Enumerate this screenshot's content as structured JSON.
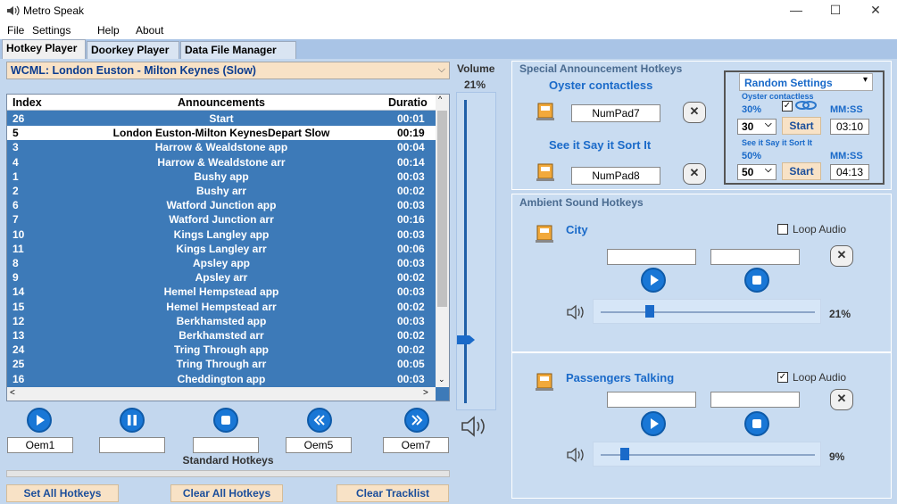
{
  "window": {
    "title": "Metro Speak",
    "minimize": "—",
    "maximize": "☐",
    "close": "✕"
  },
  "menu": [
    "File",
    "Settings",
    "Help",
    "About"
  ],
  "tabs": [
    "Hotkey Player",
    "Doorkey Player",
    "Data File Manager"
  ],
  "playlist": {
    "selected": "WCML: London Euston - Milton Keynes (Slow)",
    "columns": [
      "Index",
      "Announcements",
      "Duratio"
    ],
    "rows": [
      {
        "index": "26",
        "announcement": "Start",
        "duration": "00:01"
      },
      {
        "index": "5",
        "announcement": "London Euston-Milton KeynesDepart Slow",
        "duration": "00:19"
      },
      {
        "index": "3",
        "announcement": "Harrow & Wealdstone app",
        "duration": "00:04"
      },
      {
        "index": "4",
        "announcement": "Harrow & Wealdstone arr",
        "duration": "00:14"
      },
      {
        "index": "1",
        "announcement": "Bushy app",
        "duration": "00:03"
      },
      {
        "index": "2",
        "announcement": "Bushy arr",
        "duration": "00:02"
      },
      {
        "index": "6",
        "announcement": "Watford Junction app",
        "duration": "00:03"
      },
      {
        "index": "7",
        "announcement": "Watford Junction arr",
        "duration": "00:16"
      },
      {
        "index": "10",
        "announcement": "Kings Langley app",
        "duration": "00:03"
      },
      {
        "index": "11",
        "announcement": "Kings Langley arr",
        "duration": "00:06"
      },
      {
        "index": "8",
        "announcement": "Apsley app",
        "duration": "00:03"
      },
      {
        "index": "9",
        "announcement": "Apsley arr",
        "duration": "00:02"
      },
      {
        "index": "14",
        "announcement": "Hemel Hempstead app",
        "duration": "00:03"
      },
      {
        "index": "15",
        "announcement": "Hemel Hempstead arr",
        "duration": "00:02"
      },
      {
        "index": "12",
        "announcement": "Berkhamsted app",
        "duration": "00:03"
      },
      {
        "index": "13",
        "announcement": "Berkhamsted arr",
        "duration": "00:02"
      },
      {
        "index": "24",
        "announcement": "Tring Through app",
        "duration": "00:02"
      },
      {
        "index": "25",
        "announcement": "Tring Through arr",
        "duration": "00:05"
      },
      {
        "index": "16",
        "announcement": "Cheddington app",
        "duration": "00:03"
      }
    ],
    "selected_row": 1
  },
  "transport": {
    "hotkeys": [
      "Oem1",
      "",
      "",
      "Oem5",
      "Oem7"
    ],
    "caption": "Standard Hotkeys"
  },
  "bottom_buttons": [
    "Set All Hotkeys",
    "Clear All Hotkeys",
    "Clear Tracklist"
  ],
  "volume": {
    "label": "Volume",
    "value": "21%",
    "level": 0.21
  },
  "special": {
    "title": "Special Announcement Hotkeys",
    "item1": {
      "name": "Oyster  contactless",
      "hotkey": "NumPad7"
    },
    "item2": {
      "name": "See it Say it Sort It",
      "hotkey": "NumPad8"
    },
    "random": {
      "title": "Random Settings",
      "oyster_label": "Oyster  contactless",
      "pct1": "30%",
      "mmss1": "MM:SS",
      "sel1": "30",
      "start1": "Start",
      "time1": "03:10",
      "see_label": "See it Say it Sort It",
      "pct2": "50%",
      "mmss2": "MM:SS",
      "sel2": "50",
      "start2": "Start",
      "time2": "04:13"
    }
  },
  "ambient": {
    "title": "Ambient Sound Hotkeys",
    "city": {
      "name": "City",
      "loop_label": "Loop Audio",
      "loop": false,
      "volume": "21%",
      "level": 0.21
    },
    "passengers": {
      "name": "Passengers Talking",
      "loop_label": "Loop Audio",
      "loop": true,
      "volume": "9%",
      "level": 0.09
    }
  }
}
